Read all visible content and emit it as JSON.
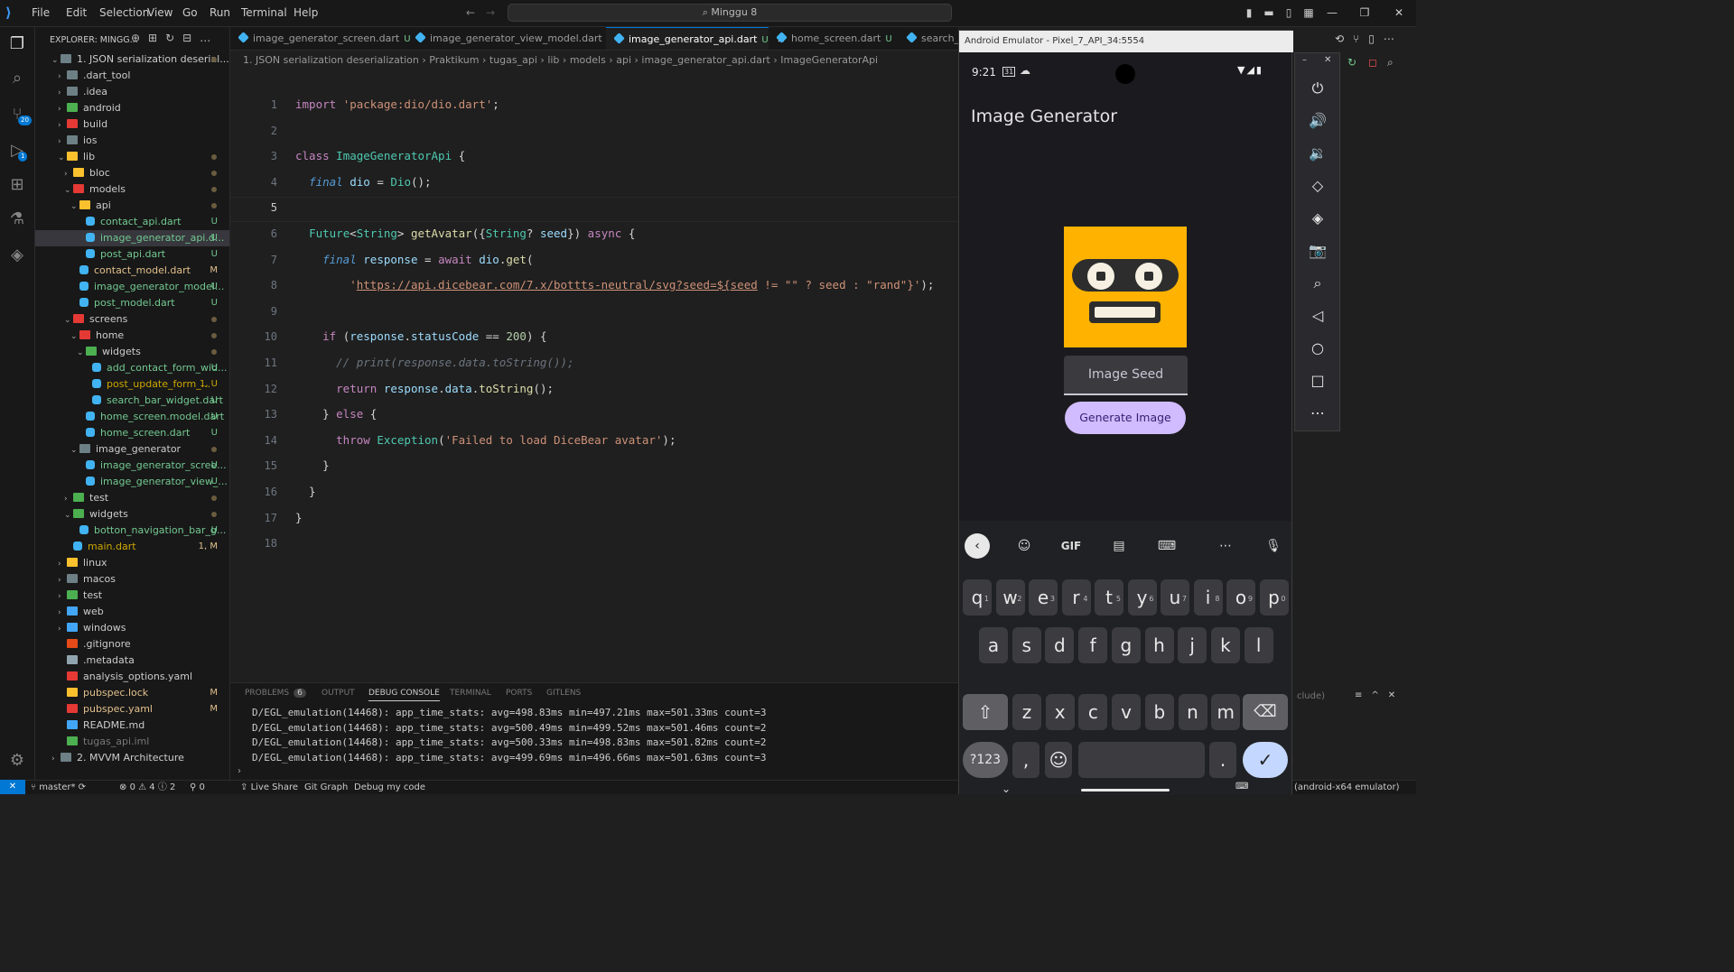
{
  "titlebar": {
    "menus": [
      "File",
      "Edit",
      "Selection",
      "View",
      "Go",
      "Run",
      "Terminal",
      "Help"
    ],
    "search": "Minggu 8"
  },
  "activity": {
    "source_badge": "20",
    "debug_badge": "1"
  },
  "explorer": {
    "header": "EXPLORER: MINGG...",
    "tree": [
      {
        "label": "1. JSON serialization deserial...",
        "indent": 0,
        "arrow": "v",
        "type": "folder-root",
        "status": "dot"
      },
      {
        "label": ".dart_tool",
        "indent": 1,
        "arrow": ">",
        "type": "folder",
        "status": ""
      },
      {
        "label": ".idea",
        "indent": 1,
        "arrow": ">",
        "type": "folder",
        "status": ""
      },
      {
        "label": "android",
        "indent": 1,
        "arrow": ">",
        "type": "folder-green",
        "status": ""
      },
      {
        "label": "build",
        "indent": 1,
        "arrow": ">",
        "type": "folder-red",
        "status": ""
      },
      {
        "label": "ios",
        "indent": 1,
        "arrow": ">",
        "type": "folder",
        "status": ""
      },
      {
        "label": "lib",
        "indent": 1,
        "arrow": "v",
        "type": "folder-yellow",
        "status": "dot"
      },
      {
        "label": "bloc",
        "indent": 2,
        "arrow": ">",
        "type": "folder-yellow",
        "status": "dot"
      },
      {
        "label": "models",
        "indent": 2,
        "arrow": "v",
        "type": "folder-red",
        "status": "dot"
      },
      {
        "label": "api",
        "indent": 3,
        "arrow": "v",
        "type": "folder-yellow",
        "status": "dot"
      },
      {
        "label": "contact_api.dart",
        "indent": 4,
        "arrow": "",
        "type": "dart",
        "status": "U"
      },
      {
        "label": "image_generator_api.d...",
        "indent": 4,
        "arrow": "",
        "type": "dart",
        "status": "U",
        "selected": true
      },
      {
        "label": "post_api.dart",
        "indent": 4,
        "arrow": "",
        "type": "dart",
        "status": "U"
      },
      {
        "label": "contact_model.dart",
        "indent": 3,
        "arrow": "",
        "type": "dart",
        "status": "M"
      },
      {
        "label": "image_generator_model...",
        "indent": 3,
        "arrow": "",
        "type": "dart",
        "status": "U"
      },
      {
        "label": "post_model.dart",
        "indent": 3,
        "arrow": "",
        "type": "dart",
        "status": "U"
      },
      {
        "label": "screens",
        "indent": 2,
        "arrow": "v",
        "type": "folder-red",
        "status": "dot"
      },
      {
        "label": "home",
        "indent": 3,
        "arrow": "v",
        "type": "folder-red",
        "status": "dot"
      },
      {
        "label": "widgets",
        "indent": 4,
        "arrow": "v",
        "type": "folder-green",
        "status": "dot"
      },
      {
        "label": "add_contact_form_wid...",
        "indent": 5,
        "arrow": "",
        "type": "dart",
        "status": "U"
      },
      {
        "label": "post_update_form_...",
        "indent": 5,
        "arrow": "",
        "type": "dart",
        "status": "1, U",
        "warn": true
      },
      {
        "label": "search_bar_widget.dart",
        "indent": 5,
        "arrow": "",
        "type": "dart",
        "status": "U"
      },
      {
        "label": "home_screen.model.dart",
        "indent": 4,
        "arrow": "",
        "type": "dart",
        "status": "U"
      },
      {
        "label": "home_screen.dart",
        "indent": 4,
        "arrow": "",
        "type": "dart",
        "status": "U"
      },
      {
        "label": "image_generator",
        "indent": 3,
        "arrow": "v",
        "type": "folder",
        "status": "dot"
      },
      {
        "label": "image_generator_scree...",
        "indent": 4,
        "arrow": "",
        "type": "dart",
        "status": "U"
      },
      {
        "label": "image_generator_view_...",
        "indent": 4,
        "arrow": "",
        "type": "dart",
        "status": "U"
      },
      {
        "label": "test",
        "indent": 2,
        "arrow": ">",
        "type": "folder-green",
        "status": "dot"
      },
      {
        "label": "widgets",
        "indent": 2,
        "arrow": "v",
        "type": "folder-green",
        "status": "dot"
      },
      {
        "label": "botton_navigation_bar_g...",
        "indent": 3,
        "arrow": "",
        "type": "dart",
        "status": "U"
      },
      {
        "label": "main.dart",
        "indent": 2,
        "arrow": "",
        "type": "dart",
        "status": "1, M",
        "warn": true
      },
      {
        "label": "linux",
        "indent": 1,
        "arrow": ">",
        "type": "folder-yellow",
        "status": ""
      },
      {
        "label": "macos",
        "indent": 1,
        "arrow": ">",
        "type": "folder",
        "status": ""
      },
      {
        "label": "test",
        "indent": 1,
        "arrow": ">",
        "type": "folder-green",
        "status": ""
      },
      {
        "label": "web",
        "indent": 1,
        "arrow": ">",
        "type": "folder-blue",
        "status": ""
      },
      {
        "label": "windows",
        "indent": 1,
        "arrow": ">",
        "type": "folder-blue",
        "status": ""
      },
      {
        "label": ".gitignore",
        "indent": 1,
        "arrow": "",
        "type": "git",
        "status": ""
      },
      {
        "label": ".metadata",
        "indent": 1,
        "arrow": "",
        "type": "file",
        "status": ""
      },
      {
        "label": "analysis_options.yaml",
        "indent": 1,
        "arrow": "",
        "type": "yaml",
        "status": ""
      },
      {
        "label": "pubspec.lock",
        "indent": 1,
        "arrow": "",
        "type": "lock",
        "status": "M"
      },
      {
        "label": "pubspec.yaml",
        "indent": 1,
        "arrow": "",
        "type": "yaml",
        "status": "M"
      },
      {
        "label": "README.md",
        "indent": 1,
        "arrow": "",
        "type": "info",
        "status": ""
      },
      {
        "label": "tugas_api.iml",
        "indent": 1,
        "arrow": "",
        "type": "iml",
        "status": "",
        "dim": true
      },
      {
        "label": "2. MVVM Architecture",
        "indent": 0,
        "arrow": ">",
        "type": "folder-root",
        "status": ""
      }
    ]
  },
  "tabs": [
    {
      "label": "image_generator_screen.dart",
      "status": "U",
      "active": false
    },
    {
      "label": "image_generator_view_model.dart",
      "status": "U",
      "active": false
    },
    {
      "label": "image_generator_api.dart",
      "status": "U",
      "active": true
    },
    {
      "label": "home_screen.dart",
      "status": "U",
      "active": false
    },
    {
      "label": "search_b",
      "status": "",
      "active": false
    }
  ],
  "breadcrumb": [
    "1. JSON serialization deserialization",
    "Praktikum",
    "tugas_api",
    "lib",
    "models",
    "api",
    "image_generator_api.dart",
    "ImageGeneratorApi"
  ],
  "code": [
    {
      "n": "1",
      "html": "<span class=\"kw\">import</span> <span class=\"str\">'package:dio/dio.dart'</span>;"
    },
    {
      "n": "2",
      "html": ""
    },
    {
      "n": "3",
      "html": "<span class=\"kw\">class</span> <span class=\"ty\">ImageGeneratorApi</span> {"
    },
    {
      "n": "4",
      "html": "  <span class=\"it\">final</span> <span class=\"vr\">dio</span> = <span class=\"ty\">Dio</span>();"
    },
    {
      "n": "5",
      "html": "",
      "cur": true
    },
    {
      "n": "6",
      "html": "  <span class=\"ty\">Future</span>&lt;<span class=\"ty\">String</span>&gt; <span class=\"fn\">getAvatar</span>({<span class=\"ty\">String</span>? <span class=\"vr\">seed</span>}) <span class=\"kw\">async</span> {"
    },
    {
      "n": "7",
      "html": "    <span class=\"it\">final</span> <span class=\"vr\">response</span> = <span class=\"kw\">await</span> <span class=\"vr\">dio</span>.<span class=\"fn\">get</span>("
    },
    {
      "n": "8",
      "html": "        <span class=\"str\">'<u>https://api.dicebear.com/7.x/bottts-neutral/svg?seed=${seed</u> != \"\" ? seed : \"rand\"}'</span>);"
    },
    {
      "n": "9",
      "html": ""
    },
    {
      "n": "10",
      "html": "    <span class=\"kw\">if</span> (<span class=\"vr\">response</span>.<span class=\"vr\">statusCode</span> == <span class=\"num\">200</span>) {"
    },
    {
      "n": "11",
      "html": "      <span class=\"cm\">// print(response.data.toString());</span>"
    },
    {
      "n": "12",
      "html": "      <span class=\"kw\">return</span> <span class=\"vr\">response</span>.<span class=\"vr\">data</span>.<span class=\"fn\">toString</span>();"
    },
    {
      "n": "13",
      "html": "    } <span class=\"kw\">else</span> {"
    },
    {
      "n": "14",
      "html": "      <span class=\"kw\">throw</span> <span class=\"ty\">Exception</span>(<span class=\"str\">'Failed to load DiceBear avatar'</span>);"
    },
    {
      "n": "15",
      "html": "    }"
    },
    {
      "n": "16",
      "html": "  }"
    },
    {
      "n": "17",
      "html": "}"
    },
    {
      "n": "18",
      "html": ""
    }
  ],
  "panel": {
    "tabs": [
      "PROBLEMS",
      "OUTPUT",
      "DEBUG CONSOLE",
      "TERMINAL",
      "PORTS",
      "GITLENS"
    ],
    "problems_count": "6",
    "active": "DEBUG CONSOLE",
    "lines": [
      "D/EGL_emulation(14468): app_time_stats: avg=498.83ms min=497.21ms max=501.33ms count=3",
      "D/EGL_emulation(14468): app_time_stats: avg=500.49ms min=499.52ms max=501.46ms count=2",
      "D/EGL_emulation(14468): app_time_stats: avg=500.33ms min=498.83ms max=501.82ms count=2",
      "D/EGL_emulation(14468): app_time_stats: avg=499.69ms min=496.66ms max=501.63ms count=3"
    ],
    "right_text": "clude)"
  },
  "statusbar": {
    "branch": "master*",
    "errors": "0",
    "warnings": "4",
    "info": "2",
    "ports": "0",
    "live_share": "Live Share",
    "git_graph": "Git Graph",
    "debug": "Debug my code",
    "device": "(android-x64 emulator)"
  },
  "emulator": {
    "title": "Android Emulator - Pixel_7_API_34:5554",
    "time": "9:21",
    "calendar": "31",
    "app_title": "Image Generator",
    "seed_label": "Image Seed",
    "button": "Generate Image",
    "keyboard": {
      "row1": [
        [
          "q",
          "1"
        ],
        [
          "w",
          "2"
        ],
        [
          "e",
          "3"
        ],
        [
          "r",
          "4"
        ],
        [
          "t",
          "5"
        ],
        [
          "y",
          "6"
        ],
        [
          "u",
          "7"
        ],
        [
          "i",
          "8"
        ],
        [
          "o",
          "9"
        ],
        [
          "p",
          "0"
        ]
      ],
      "row2": [
        "a",
        "s",
        "d",
        "f",
        "g",
        "h",
        "j",
        "k",
        "l"
      ],
      "row3": [
        "z",
        "x",
        "c",
        "v",
        "b",
        "n",
        "m"
      ],
      "symbols": "?123",
      "comma": ",",
      "period": ".",
      "gif": "GIF"
    }
  },
  "colors": {
    "accent": "#0078d4",
    "robot": "#ffb300",
    "button": "#d0bcff"
  }
}
